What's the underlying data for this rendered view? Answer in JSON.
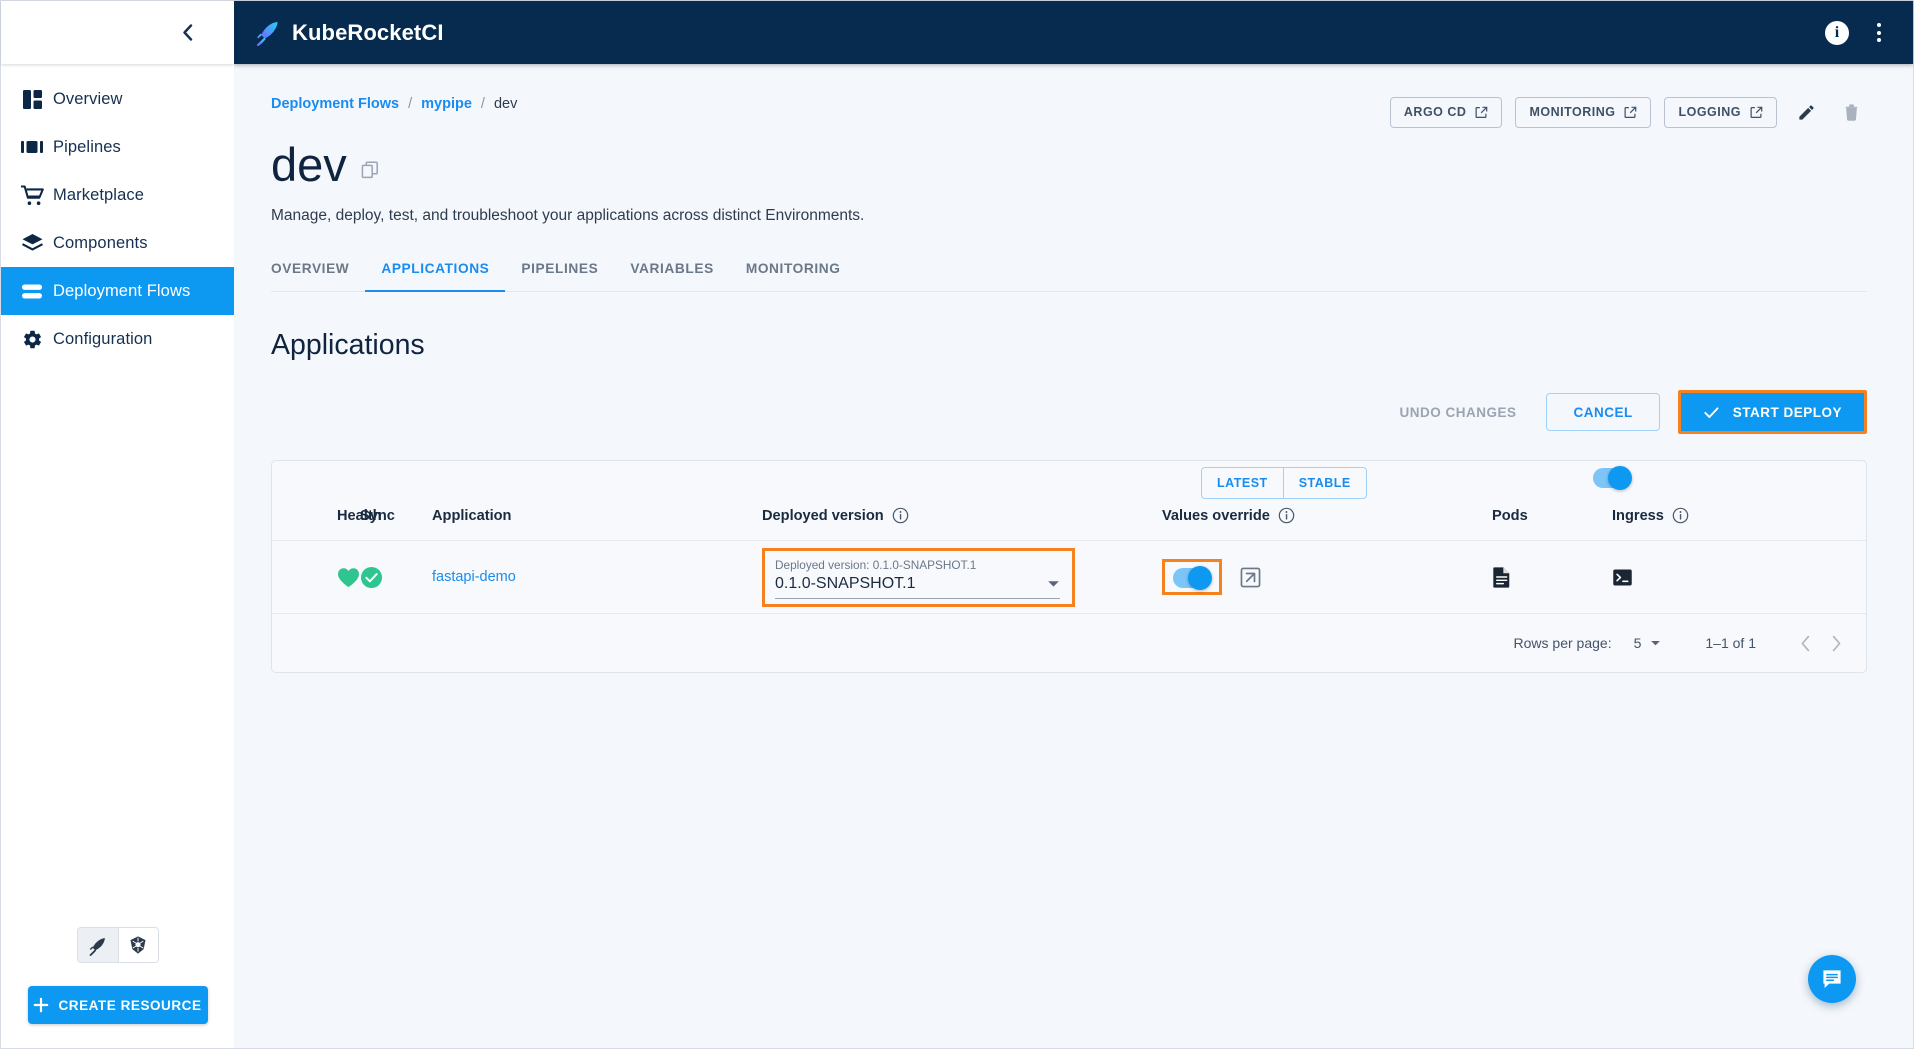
{
  "app": {
    "brand_name": "KubeRocketCI",
    "logo_icon": "rocket-feather-icon",
    "info_icon": "info-icon",
    "menu_icon": "kebab-menu-icon",
    "collapse_icon": "chevron-left-icon"
  },
  "sidebar": {
    "items": [
      {
        "label": "Overview",
        "icon": "dashboard-icon",
        "active": false
      },
      {
        "label": "Pipelines",
        "icon": "pipelines-icon",
        "active": false
      },
      {
        "label": "Marketplace",
        "icon": "cart-icon",
        "active": false
      },
      {
        "label": "Components",
        "icon": "layers-icon",
        "active": false
      },
      {
        "label": "Deployment Flows",
        "icon": "deployment-flows-icon",
        "active": true
      },
      {
        "label": "Configuration",
        "icon": "gear-icon",
        "active": false
      }
    ],
    "cluster_switch": [
      {
        "icon": "rocket-feather-icon",
        "selected": true
      },
      {
        "icon": "kubernetes-icon",
        "selected": false
      }
    ],
    "create_resource_label": "CREATE RESOURCE",
    "create_resource_icon": "plus-icon"
  },
  "breadcrumb": {
    "root": "Deployment Flows",
    "sep": "/",
    "parent": "mypipe",
    "current": "dev"
  },
  "header": {
    "title": "dev",
    "copy_icon": "copy-icon",
    "subtitle": "Manage, deploy, test, and troubleshoot your applications across distinct Environments.",
    "actions": [
      {
        "label": "ARGO CD",
        "icon": "external-link-icon"
      },
      {
        "label": "MONITORING",
        "icon": "external-link-icon"
      },
      {
        "label": "LOGGING",
        "icon": "external-link-icon"
      }
    ],
    "edit_icon": "pencil-icon",
    "delete_icon": "trash-icon"
  },
  "tabs": [
    {
      "label": "OVERVIEW",
      "active": false
    },
    {
      "label": "APPLICATIONS",
      "active": true
    },
    {
      "label": "PIPELINES",
      "active": false
    },
    {
      "label": "VARIABLES",
      "active": false
    },
    {
      "label": "MONITORING",
      "active": false
    }
  ],
  "main": {
    "section_title": "Applications",
    "undo_label": "UNDO CHANGES",
    "cancel_label": "CANCEL",
    "start_deploy_label": "START DEPLOY",
    "start_deploy_icon": "check-icon",
    "start_deploy_highlight": "#f5821f"
  },
  "table": {
    "segmented": [
      {
        "label": "LATEST"
      },
      {
        "label": "STABLE"
      }
    ],
    "values_override_header_toggle": {
      "state": "on"
    },
    "columns": {
      "health": "Health",
      "sync": "Sync",
      "application": "Application",
      "deployed_version": "Deployed version",
      "values_override": "Values override",
      "pods": "Pods",
      "ingress": "Ingress"
    },
    "info_icon": "info-icon",
    "rows": [
      {
        "health_icon": "heart-icon",
        "health_color": "#2fc58f",
        "sync_icon": "check-circle-icon",
        "sync_color": "#2fc58f",
        "application": "fastapi-demo",
        "version_label": "Deployed version: 0.1.0-SNAPSHOT.1",
        "version_value": "0.1.0-SNAPSHOT.1",
        "version_caret_icon": "chevron-down-icon",
        "values_override_toggle": "on",
        "values_override_link_icon": "external-link-icon",
        "pods_icon": "document-icon",
        "ingress_icon": "terminal-icon"
      }
    ]
  },
  "pagination": {
    "rows_per_page_label": "Rows per page:",
    "rows_per_page_value": "5",
    "range": "1–1 of 1",
    "prev_icon": "chevron-left-icon",
    "next_icon": "chevron-right-icon"
  },
  "fab": {
    "icon": "chat-icon",
    "color": "#0d99f2"
  }
}
